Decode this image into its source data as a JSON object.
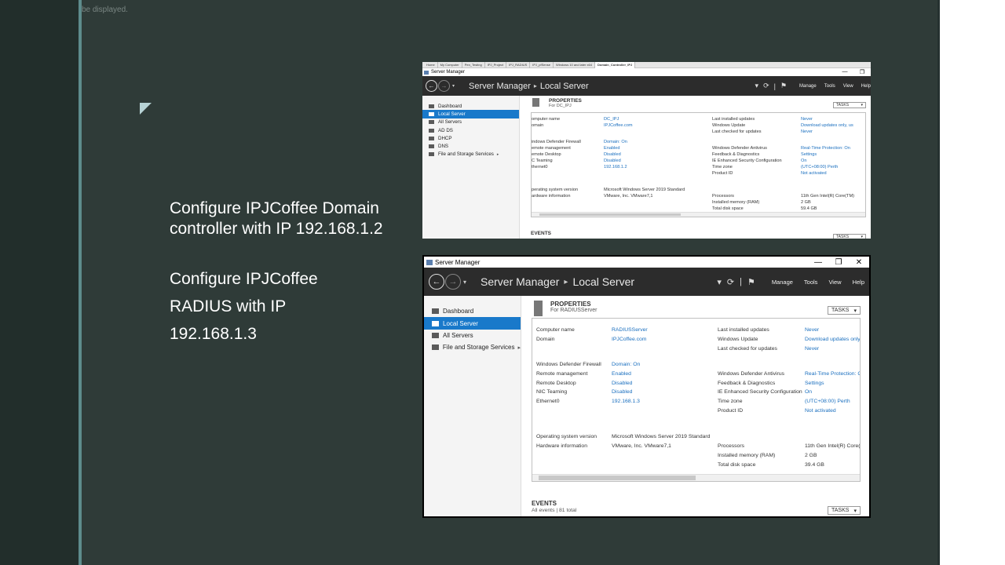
{
  "slide": {
    "top_note": "be displayed.",
    "text1": "Configure IPJCoffee Domain controller with IP 192.168.1.2",
    "text2": "Configure IPJCoffee",
    "text3": "RADIUS with IP",
    "text4": "192.168.1.3"
  },
  "win1": {
    "browser_tabs": [
      "Home",
      "My Computer",
      "Pen_Testing",
      "IPJ_Project",
      "IPJ_RADIUS",
      "IPJ_pfSense",
      "Windows 10 and later x64",
      "Domain_Controller_IPJ"
    ],
    "titlebar": "Server Manager",
    "controls": {
      "min": "—",
      "max": "❐",
      "close": "✕"
    },
    "header_title": "Server Manager",
    "header_sep": "▸",
    "header_page": "Local Server",
    "menu": [
      "Manage",
      "Tools",
      "View",
      "Help"
    ],
    "sidebar": [
      {
        "label": "Dashboard",
        "icon": "dashboard-icon"
      },
      {
        "label": "Local Server",
        "icon": "server-icon",
        "active": true
      },
      {
        "label": "All Servers",
        "icon": "servers-icon"
      },
      {
        "label": "AD DS",
        "icon": "adds-icon"
      },
      {
        "label": "DHCP",
        "icon": "dhcp-icon"
      },
      {
        "label": "DNS",
        "icon": "dns-icon"
      },
      {
        "label": "File and Storage Services",
        "icon": "storage-icon",
        "arrow": "▸"
      }
    ],
    "props_title": "PROPERTIES",
    "props_sub": "For DC_IPJ",
    "tasks": "TASKS",
    "col1_labels": [
      "omputer name",
      "omain",
      "indows Defender Firewall",
      "emote management",
      "emote Desktop",
      "C Teaming",
      "thernet0",
      "perating system version",
      "ardware information"
    ],
    "col1_values": [
      "DC_IPJ",
      "IPJCoffee.com",
      "Domain: On",
      "Enabled",
      "Disabled",
      "Disabled",
      "192.168.1.2",
      "Microsoft Windows Server 2019 Standard",
      "VMware, Inc. VMware7,1"
    ],
    "col2_labels": [
      "Last installed updates",
      "Windows Update",
      "Last checked for updates",
      "Windows Defender Antivirus",
      "Feedback & Diagnostics",
      "IE Enhanced Security Configuration",
      "Time zone",
      "Product ID",
      "Processors",
      "Installed memory (RAM)",
      "Total disk space"
    ],
    "col2_values": [
      "Never",
      "Download updates only, us",
      "Never",
      "Real-Time Protection: On",
      "Settings",
      "On",
      "(UTC+08:00) Perth",
      "Not activated",
      "11th Gen Intel(R) Core(TM)",
      "2 GB",
      "59.4 GB"
    ],
    "events_title": "EVENTS"
  },
  "win2": {
    "titlebar": "Server Manager",
    "controls": {
      "min": "—",
      "max": "❐",
      "close": "✕"
    },
    "header_title": "Server Manager",
    "header_sep": "▸",
    "header_page": "Local Server",
    "menu": [
      "Manage",
      "Tools",
      "View",
      "Help"
    ],
    "sidebar": [
      {
        "label": "Dashboard",
        "icon": "dashboard-icon"
      },
      {
        "label": "Local Server",
        "icon": "server-icon",
        "active": true
      },
      {
        "label": "All Servers",
        "icon": "servers-icon"
      },
      {
        "label": "File and Storage Services",
        "icon": "storage-icon",
        "arrow": "▸"
      }
    ],
    "props_title": "PROPERTIES",
    "props_sub": "For RADIUSServer",
    "tasks": "TASKS",
    "col1_labels": [
      "Computer name",
      "Domain",
      "Windows Defender Firewall",
      "Remote management",
      "Remote Desktop",
      "NIC Teaming",
      "Ethernet0",
      "Operating system version",
      "Hardware information"
    ],
    "col1_values": [
      "RADIUSServer",
      "IPJCoffee.com",
      "Domain: On",
      "Enabled",
      "Disabled",
      "Disabled",
      "192.168.1.3",
      "Microsoft Windows Server 2019 Standard",
      "VMware, Inc. VMware7,1"
    ],
    "col2_labels": [
      "Last installed updates",
      "Windows Update",
      "Last checked for updates",
      "Windows Defender Antivirus",
      "Feedback & Diagnostics",
      "IE Enhanced Security Configuration",
      "Time zone",
      "Product ID",
      "Processors",
      "Installed memory (RAM)",
      "Total disk space"
    ],
    "col2_values": [
      "Never",
      "Download updates only",
      "Never",
      "Real-Time Protection: C",
      "Settings",
      "On",
      "(UTC+08:00) Perth",
      "Not activated",
      "11th Gen Intel(R) Core(",
      "2 GB",
      "39.4 GB"
    ],
    "events_title": "EVENTS",
    "events_sub": "All events | 81 total"
  },
  "colors": {
    "slide_bg": "#2f3b38",
    "accent": "#5e8c8c",
    "sm_header": "#2c2c2c",
    "sm_active": "#1979ca",
    "link": "#1a6fbf"
  }
}
